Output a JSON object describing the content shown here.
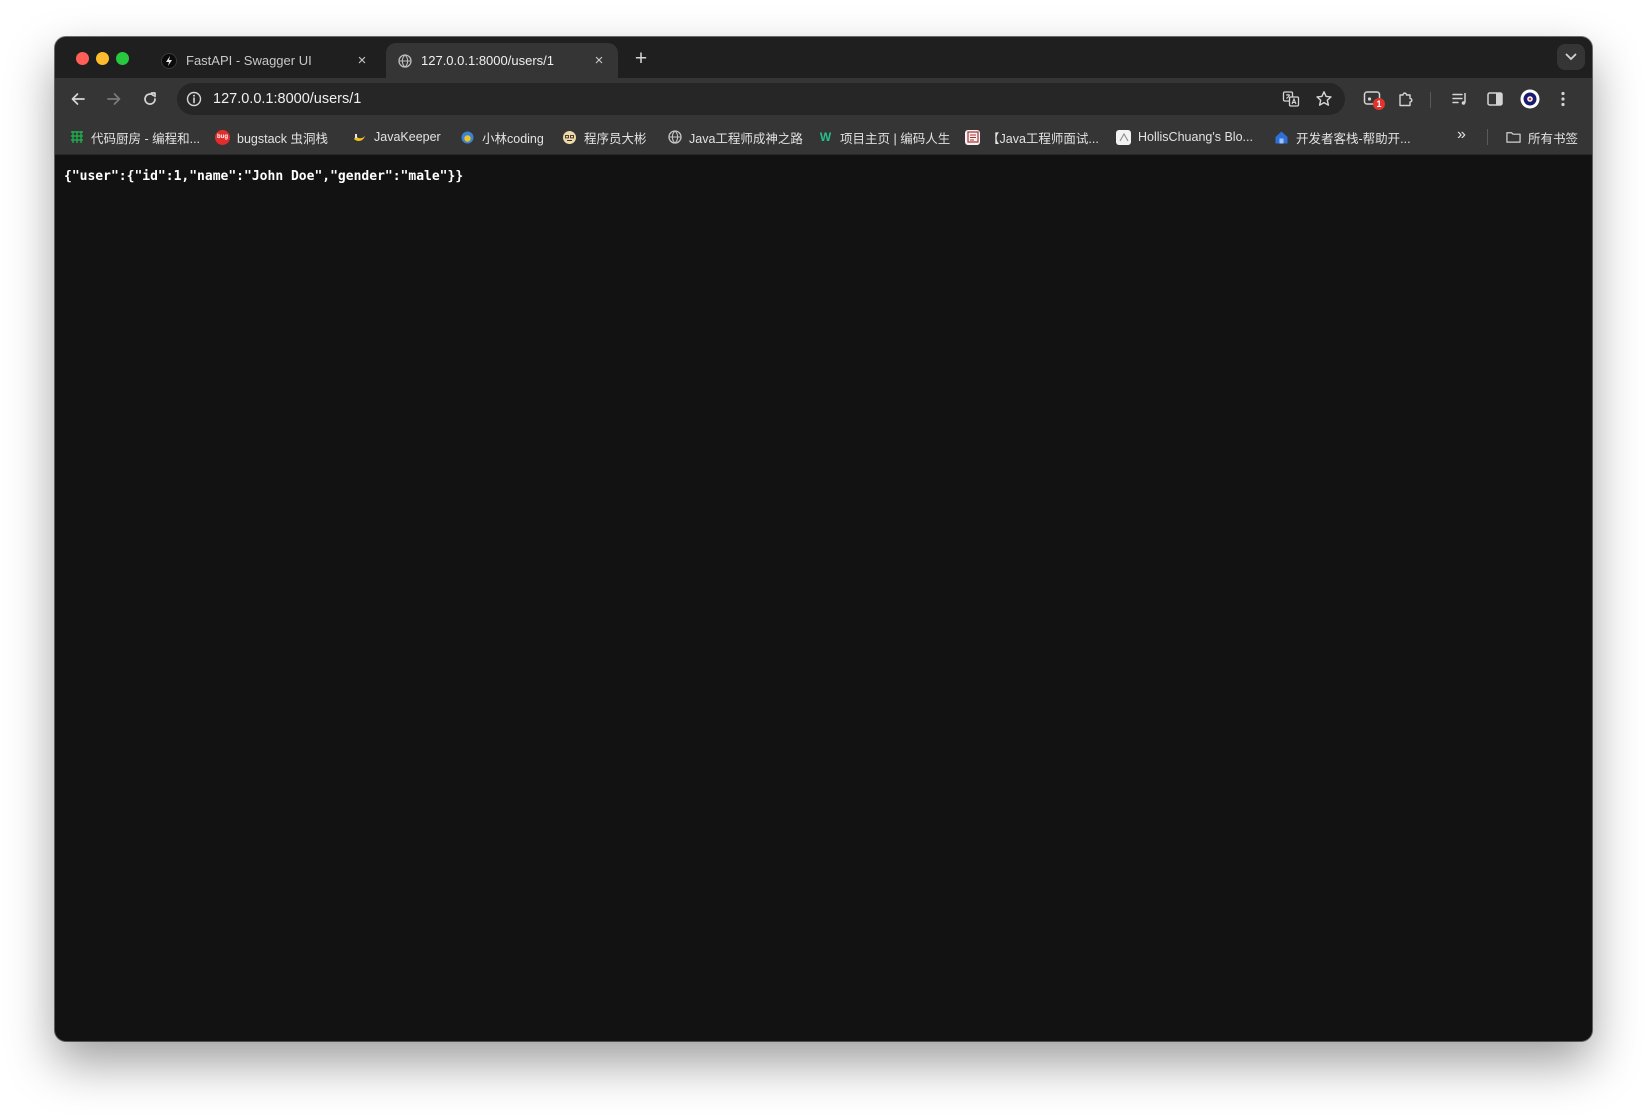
{
  "tabs": [
    {
      "title": "FastAPI - Swagger UI",
      "active": false,
      "favicon": "fastapi-icon"
    },
    {
      "title": "127.0.0.1:8000/users/1",
      "active": true,
      "favicon": "globe-icon"
    }
  ],
  "tab_close_glyph": "×",
  "new_tab_glyph": "+",
  "address_bar": {
    "url": "127.0.0.1:8000/users/1"
  },
  "extension_badge": "1",
  "bookmarks": [
    {
      "label": "代码厨房 - 编程和...",
      "icon": "code-kitchen-icon"
    },
    {
      "label": "bugstack 虫洞栈",
      "icon": "bugstack-icon"
    },
    {
      "label": "JavaKeeper",
      "icon": "javakeeper-icon"
    },
    {
      "label": "小林coding",
      "icon": "xiaolin-icon"
    },
    {
      "label": "程序员大彬",
      "icon": "dabin-icon"
    },
    {
      "label": "Java工程师成神之路",
      "icon": "globe-icon"
    },
    {
      "label": "项目主页 | 编码人生",
      "icon": "w-icon"
    },
    {
      "label": "【Java工程师面试...",
      "icon": "interview-icon"
    },
    {
      "label": "HollisChuang's Blo...",
      "icon": "hollis-icon"
    },
    {
      "label": "开发者客栈-帮助开...",
      "icon": "devhouse-icon"
    }
  ],
  "bookmarks_overflow": "»",
  "all_bookmarks_label": "所有书签",
  "page": {
    "json_text": "{\"user\":{\"id\":1,\"name\":\"John Doe\",\"gender\":\"male\"}}"
  },
  "colors": {
    "titlebar": "#1f1f1f",
    "toolbar": "#353535",
    "content_bg": "#121212",
    "traffic_close": "#ff5f57",
    "traffic_min": "#febc2e",
    "traffic_max": "#28c840"
  }
}
